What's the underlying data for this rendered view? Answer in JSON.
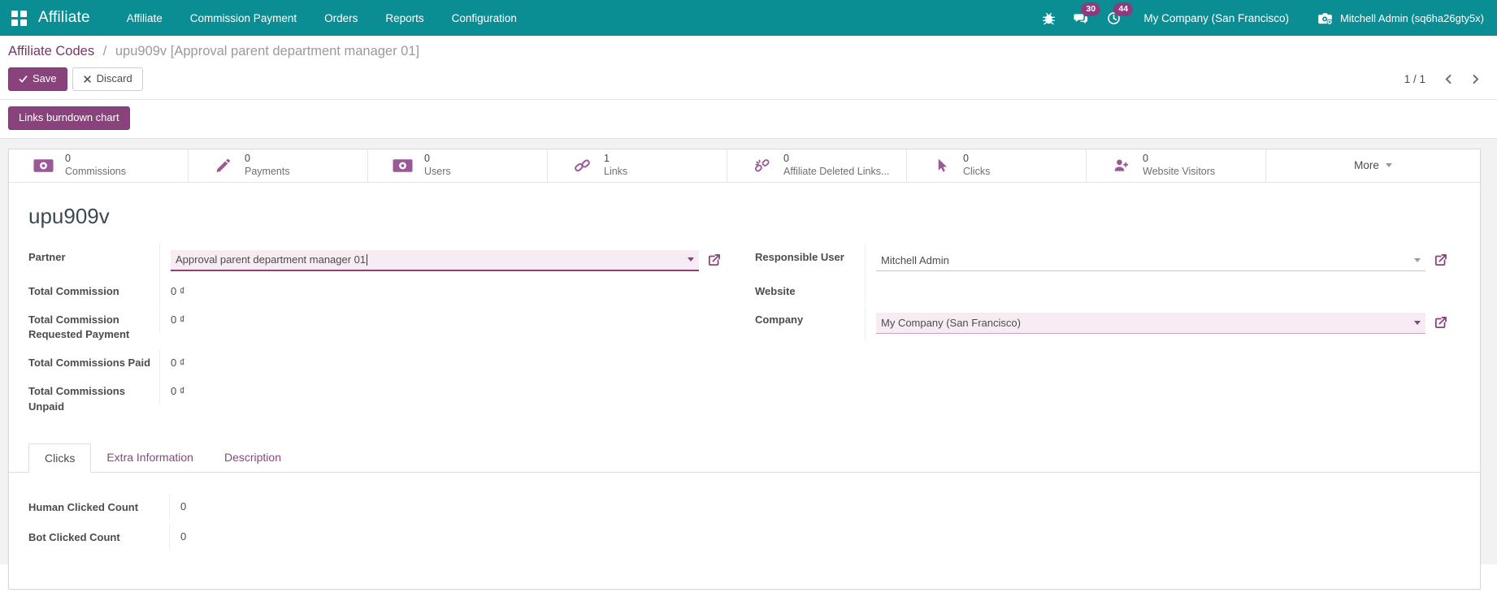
{
  "topbar": {
    "brand": "Affiliate",
    "menu_items": [
      "Affiliate",
      "Commission Payment",
      "Orders",
      "Reports",
      "Configuration"
    ],
    "messages_count": "30",
    "activities_count": "44",
    "company_switcher": "My Company (San Francisco)",
    "user_menu": "Mitchell Admin (sq6ha26gty5x)"
  },
  "breadcrumb": {
    "parent": "Affiliate Codes",
    "separator": "/",
    "current": "upu909v [Approval parent department manager 01]"
  },
  "control_panel": {
    "save_label": "Save",
    "discard_label": "Discard",
    "pager": "1 / 1"
  },
  "action_buttons": {
    "links_burndown_label": "Links burndown chart"
  },
  "stat_buttons": [
    {
      "value": "0",
      "label": "Commissions",
      "icon": "money-icon"
    },
    {
      "value": "0",
      "label": "Payments",
      "icon": "pencil-icon"
    },
    {
      "value": "0",
      "label": "Users",
      "icon": "money-icon"
    },
    {
      "value": "1",
      "label": "Links",
      "icon": "chain-icon"
    },
    {
      "value": "0",
      "label": "Affiliate Deleted Links...",
      "icon": "chain-broken-icon"
    },
    {
      "value": "0",
      "label": "Clicks",
      "icon": "cursor-icon"
    },
    {
      "value": "0",
      "label": "Website Visitors",
      "icon": "user-plus-icon"
    }
  ],
  "more_button_label": "More",
  "form": {
    "title": "upu909v",
    "fields_left": {
      "partner": {
        "label": "Partner",
        "value": "Approval parent department manager 01"
      },
      "total_commission": {
        "label": "Total Commission",
        "value": "0 ₫"
      },
      "total_commission_requested_payment": {
        "label": "Total Commission Requested Payment",
        "value": "0 ₫"
      },
      "total_commissions_paid": {
        "label": "Total Commissions Paid",
        "value": "0 ₫"
      },
      "total_commissions_unpaid": {
        "label": "Total Commissions Unpaid",
        "value": "0 ₫"
      }
    },
    "fields_right": {
      "responsible_user": {
        "label": "Responsible User",
        "value": "Mitchell Admin"
      },
      "website": {
        "label": "Website",
        "value": ""
      },
      "company": {
        "label": "Company",
        "value": "My Company (San Francisco)"
      }
    }
  },
  "tabs": [
    {
      "label": "Clicks",
      "active": true
    },
    {
      "label": "Extra Information",
      "active": false
    },
    {
      "label": "Description",
      "active": false
    }
  ],
  "clicks_tab": {
    "human_clicked": {
      "label": "Human Clicked Count",
      "value": "0"
    },
    "bot_clicked": {
      "label": "Bot Clicked Count",
      "value": "0"
    }
  },
  "colors": {
    "topbar_bg": "#0a8e94",
    "primary_purple": "#8a427c",
    "badge_bg": "#8a3c7f",
    "stat_icon_purple": "#9a5896",
    "input_highlight_bg": "#f8ecf4",
    "breadcrumb_link": "#7a3468"
  }
}
